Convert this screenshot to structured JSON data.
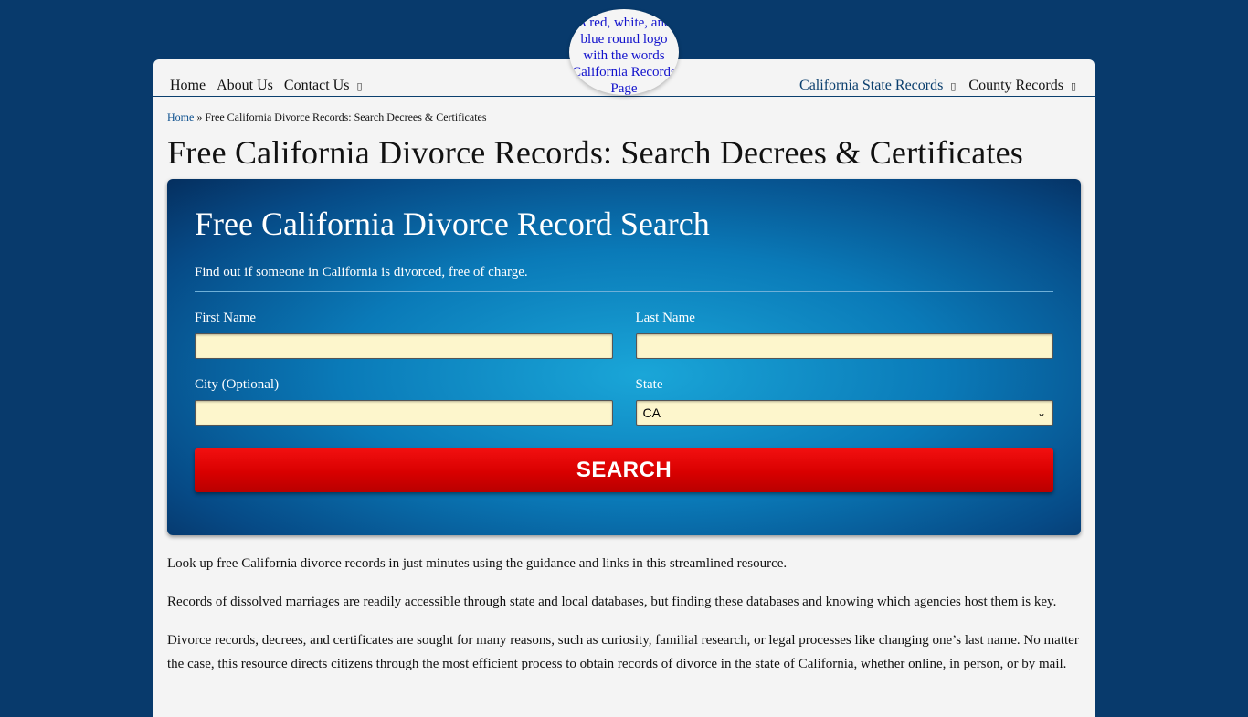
{
  "logo": {
    "alt_text": "A red, white, and blue round logo with the words California Records Page"
  },
  "nav": {
    "left": [
      {
        "label": "Home"
      },
      {
        "label": "About Us"
      },
      {
        "label": "Contact Us",
        "has_dropdown": true
      }
    ],
    "right": [
      {
        "label": "California State Records",
        "has_dropdown": true
      },
      {
        "label": "County Records",
        "has_dropdown": true
      }
    ],
    "dropdown_glyph": "▯"
  },
  "breadcrumb": {
    "home": "Home",
    "separator": "»",
    "current": "Free California Divorce Records: Search Decrees & Certificates"
  },
  "page_title": "Free California Divorce Records: Search Decrees & Certificates",
  "search": {
    "title": "Free California Divorce Record Search",
    "subtitle": "Find out if someone in California is divorced, free of charge.",
    "first_name_label": "First Name",
    "first_name_value": "",
    "last_name_label": "Last Name",
    "last_name_value": "",
    "city_label": "City (Optional)",
    "city_value": "",
    "state_label": "State",
    "state_value": "CA",
    "button_label": "SEARCH"
  },
  "body": {
    "p1": "Look up free California divorce records in just minutes using the guidance and links in this streamlined resource.",
    "p2": "Records of dissolved marriages are readily accessible through state and local databases, but finding these databases and knowing which agencies host them is key.",
    "p3": "Divorce records, decrees, and certificates are sought for many reasons, such as curiosity, familial research, or legal processes like changing one’s last name. No matter the case, this resource directs citizens through the most efficient process to obtain records of divorce in the state of California, whether online, in person, or by mail."
  },
  "colors": {
    "background": "#083a6c",
    "link_blue": "#0b3f6e",
    "search_button": "#e00000",
    "input_fill": "#fdf6cc"
  }
}
